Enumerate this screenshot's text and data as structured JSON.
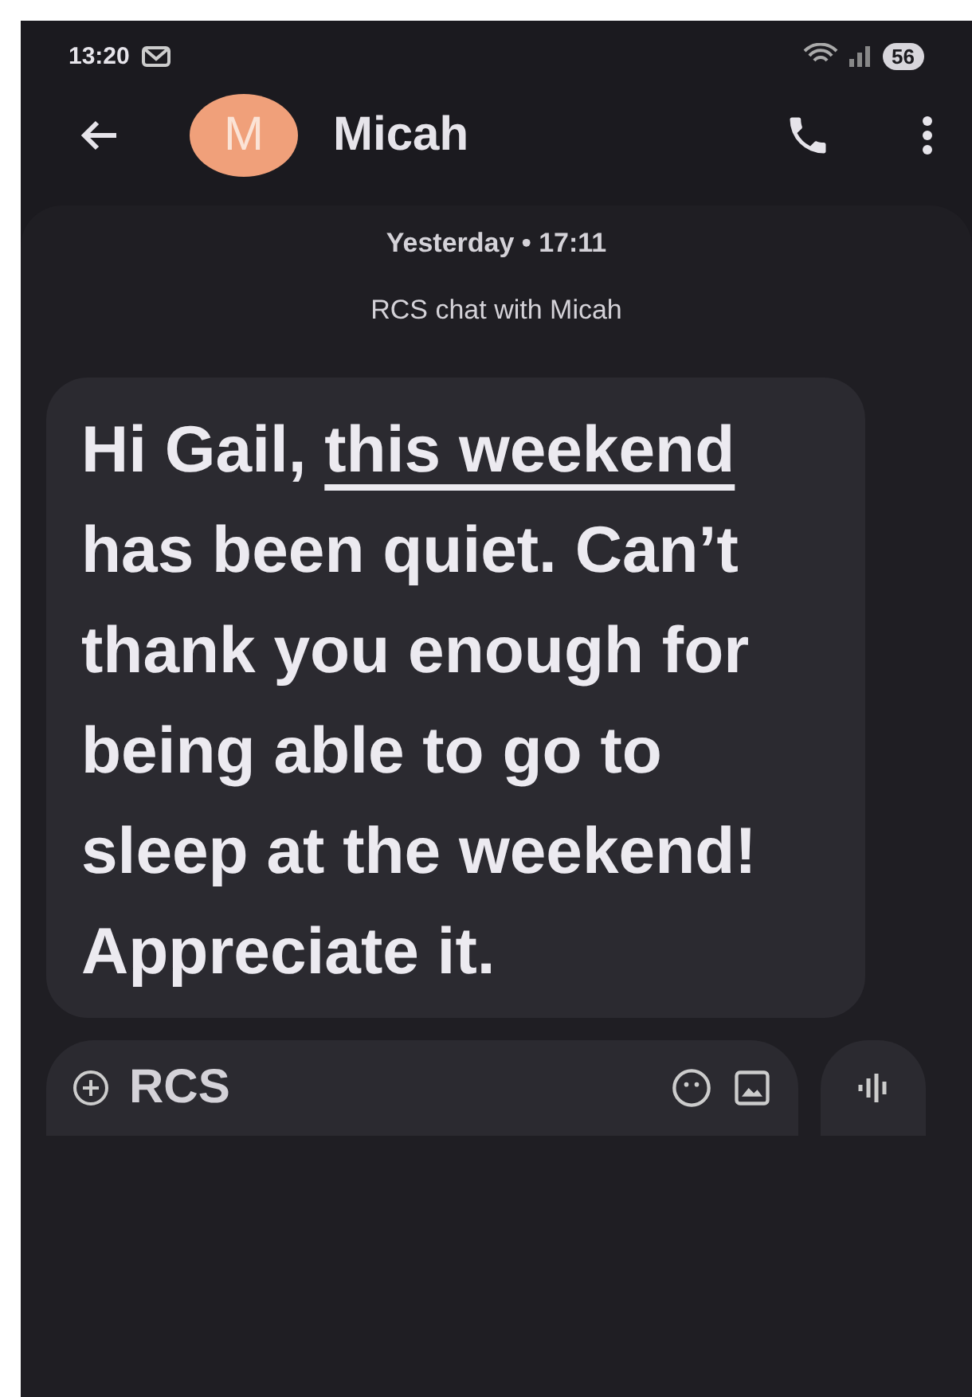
{
  "status_bar": {
    "time": "13:20",
    "battery": "56"
  },
  "header": {
    "avatar_letter": "M",
    "contact": "Micah"
  },
  "timestamp": "Yesterday • 17:11",
  "chat_info": "RCS chat with Micah",
  "message": {
    "parts": [
      {
        "kind": "text",
        "text": "Hi Gail, "
      },
      {
        "kind": "link",
        "text": "this weekend"
      },
      {
        "kind": "text",
        "text": " has been quiet. Can’t thank you enough for being able to go to sleep at the weekend! Appreciate it."
      }
    ]
  },
  "composer": {
    "placeholder": "RCS"
  }
}
